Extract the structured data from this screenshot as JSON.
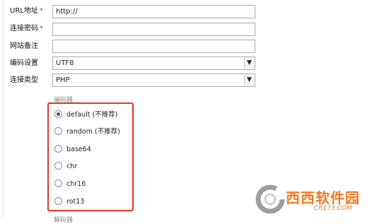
{
  "form": {
    "url": {
      "label": "URL地址",
      "required": "*",
      "value": "http://"
    },
    "password": {
      "label": "连接密码",
      "required": "*",
      "value": ""
    },
    "note": {
      "label": "网站备注",
      "value": ""
    },
    "encoding": {
      "label": "编码设置",
      "selected": "UTF8"
    },
    "type": {
      "label": "连接类型",
      "selected": "PHP"
    }
  },
  "encoder": {
    "title": "编码器",
    "options": [
      {
        "label": "default (不推荐)",
        "checked": true
      },
      {
        "label": "random (不推荐)",
        "checked": false
      },
      {
        "label": "base64",
        "checked": false
      },
      {
        "label": "chr",
        "checked": false
      },
      {
        "label": "chr16",
        "checked": false
      },
      {
        "label": "rot13",
        "checked": false
      }
    ],
    "next_section": "解码器"
  },
  "watermark": {
    "text": "西西软件园",
    "url": "CR173.COM"
  },
  "colors": {
    "highlight_border": "#d9382a",
    "required_star": "#e02222",
    "watermark": "#f07a22"
  }
}
